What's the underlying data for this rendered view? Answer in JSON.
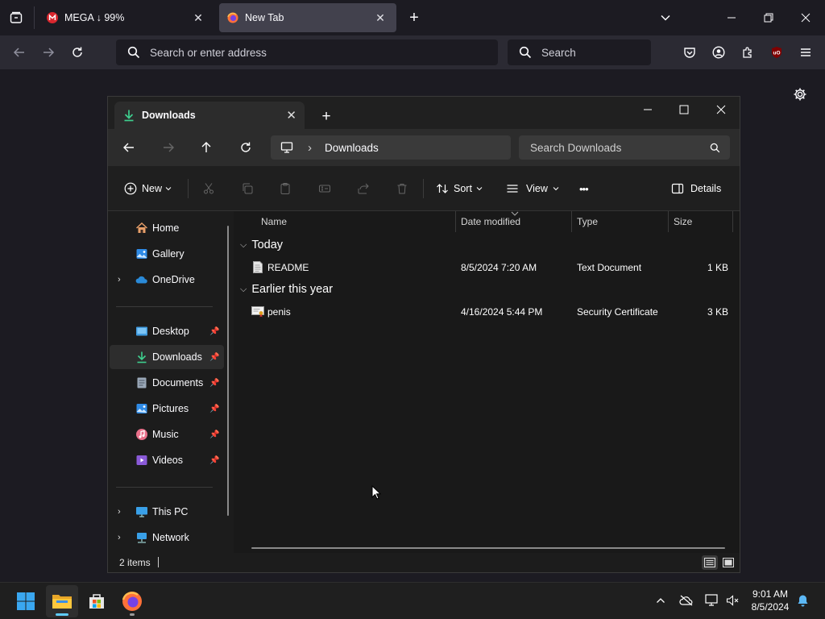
{
  "browser": {
    "tabs": [
      {
        "title": "MEGA ↓ 99%",
        "close": "✕",
        "selected": false
      },
      {
        "title": "New Tab",
        "close": "✕",
        "selected": true
      }
    ],
    "new_tab_glyph": "+",
    "address_placeholder": "Search or enter address",
    "search_placeholder": "Search",
    "colors": {
      "tab_strip": "#1c1b22",
      "toolbar": "#2b2a33",
      "selected_tab": "#42414d"
    },
    "toolbar_icons": [
      "pocket-icon",
      "account-icon",
      "extensions-icon",
      "ublock-origin-icon",
      "app-menu-icon"
    ],
    "ublock_badge": "uO"
  },
  "explorer": {
    "tab_title": "Downloads",
    "tab_close": "✕",
    "new_tab_glyph": "+",
    "window_controls": {
      "minimize": "—",
      "maximize": "☐",
      "close": "✕"
    },
    "breadcrumb": {
      "separator": "›",
      "location": "Downloads"
    },
    "search_placeholder": "Search Downloads",
    "commands": {
      "new": "New",
      "sort": "Sort",
      "view": "View",
      "more": "•••",
      "details": "Details"
    },
    "nav": [
      {
        "label": "Home",
        "icon": "home-icon"
      },
      {
        "label": "Gallery",
        "icon": "gallery-icon"
      },
      {
        "label": "OneDrive",
        "icon": "onedrive-icon",
        "expandable": true
      },
      {
        "label": "Desktop",
        "icon": "desktop-folder-icon",
        "pinned": true
      },
      {
        "label": "Downloads",
        "icon": "downloads-folder-icon",
        "pinned": true,
        "selected": true
      },
      {
        "label": "Documents",
        "icon": "documents-folder-icon",
        "pinned": true
      },
      {
        "label": "Pictures",
        "icon": "pictures-folder-icon",
        "pinned": true
      },
      {
        "label": "Music",
        "icon": "music-folder-icon",
        "pinned": true
      },
      {
        "label": "Videos",
        "icon": "videos-folder-icon",
        "pinned": true
      },
      {
        "label": "This PC",
        "icon": "this-pc-icon",
        "expandable": true
      },
      {
        "label": "Network",
        "icon": "network-icon",
        "expandable": true
      }
    ],
    "columns": [
      "Name",
      "Date modified",
      "Type",
      "Size"
    ],
    "groups": [
      {
        "label": "Today",
        "files": [
          {
            "name": "README",
            "date": "8/5/2024 7:20 AM",
            "type": "Text Document",
            "size": "1 KB",
            "icon": "text-document-icon"
          }
        ]
      },
      {
        "label": "Earlier this year",
        "files": [
          {
            "name": "penis",
            "date": "4/16/2024 5:44 PM",
            "type": "Security Certificate",
            "size": "3 KB",
            "icon": "certificate-icon"
          }
        ]
      }
    ],
    "status": {
      "items": "2 items"
    }
  },
  "taskbar": {
    "apps": [
      "start-icon",
      "file-explorer-icon",
      "microsoft-store-icon",
      "firefox-icon"
    ],
    "time": "9:01 AM",
    "date": "8/5/2024"
  }
}
